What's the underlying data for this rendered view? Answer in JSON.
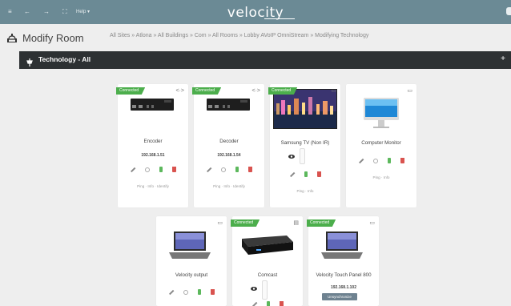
{
  "topbar": {
    "menu_icon": "≡",
    "back_icon": "←",
    "forward_icon": "→",
    "screen_icon": "⛶",
    "help_label": "Help ▾",
    "logo": "velocity"
  },
  "page": {
    "title": "Modify Room",
    "breadcrumb": "All Sites » Atlona » All Buildings » Com » All Rooms » Lobby AVoIP OmniStream » Modifying Technology"
  },
  "section": {
    "title": "Technology - All",
    "add_label": "+"
  },
  "cards": [
    {
      "name": "Encoder",
      "status": "Connected",
      "ip": "192.168.1.51",
      "links": "Ping · Info · Identify",
      "corner_icon": "<·>"
    },
    {
      "name": "Decoder",
      "status": "Connected",
      "ip": "192.168.1.54",
      "links": "Ping · Info · Identify",
      "corner_icon": "<·>"
    },
    {
      "name": "Samsung TV (Non IR)",
      "status": "Connected",
      "links": "Ping · Info",
      "corner_icon": "▭"
    },
    {
      "name": "Computer Monitor",
      "links": "Ping · Info",
      "corner_icon": "▭"
    },
    {
      "name": "Velocity output",
      "corner_icon": "▭"
    },
    {
      "name": "Comcast",
      "status": "Connected",
      "corner_icon": "▤"
    },
    {
      "name": "Velocity Touch Panel 800",
      "status": "Connected",
      "ip": "192.168.1.102",
      "button": "Unsynchronize",
      "corner_icon": "▭"
    }
  ],
  "colors": {
    "topbar": "#6b8a95",
    "section_bar": "#2d3133",
    "connected": "#4cae4c",
    "battery": "#5cb85c",
    "trash": "#d9534f"
  }
}
